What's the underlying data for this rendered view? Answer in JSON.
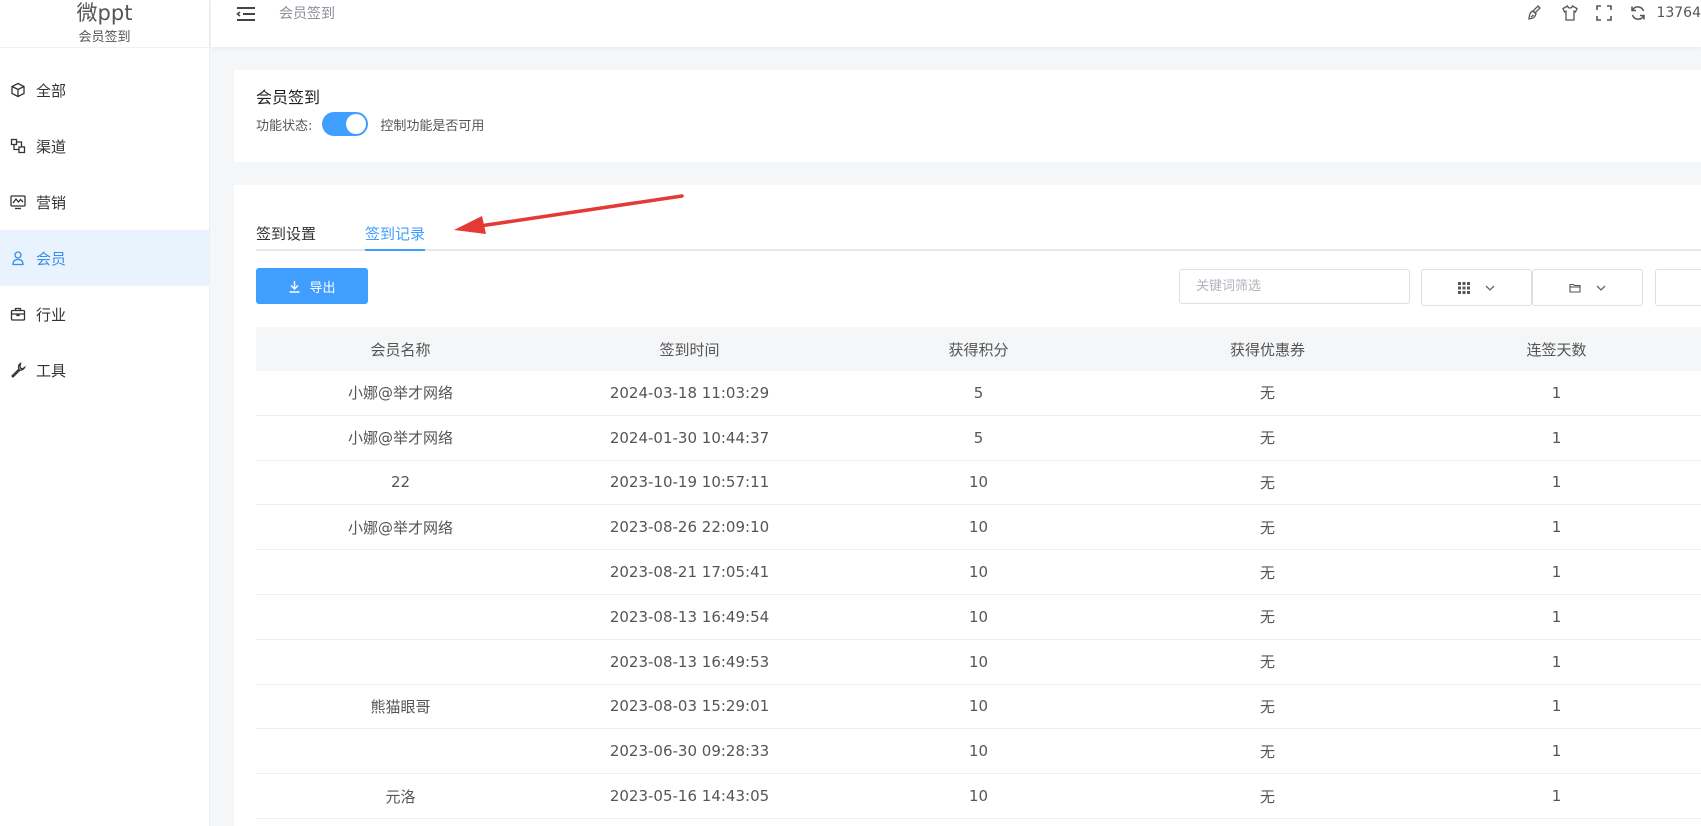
{
  "brand": {
    "name": "微ppt",
    "subtitle": "会员签到"
  },
  "sidebar": {
    "items": [
      {
        "label": "全部",
        "icon": "cube-icon"
      },
      {
        "label": "渠道",
        "icon": "channel-icon"
      },
      {
        "label": "营销",
        "icon": "chart-icon"
      },
      {
        "label": "会员",
        "icon": "user-icon",
        "active": true
      },
      {
        "label": "行业",
        "icon": "briefcase-icon"
      },
      {
        "label": "工具",
        "icon": "wrench-icon"
      }
    ]
  },
  "header": {
    "breadcrumb": "会员签到",
    "user": "13764",
    "icons": [
      "brush-icon",
      "shirt-icon",
      "fullscreen-icon",
      "refresh-icon"
    ]
  },
  "feature": {
    "title": "会员签到",
    "status_label": "功能状态:",
    "toggle_on": true,
    "description": "控制功能是否可用"
  },
  "tabs": [
    {
      "label": "签到设置",
      "active": false
    },
    {
      "label": "签到记录",
      "active": true
    }
  ],
  "toolbar": {
    "export_label": "导出",
    "search_placeholder": "关键词筛选"
  },
  "table": {
    "columns": [
      "会员名称",
      "签到时间",
      "获得积分",
      "获得优惠券",
      "连签天数"
    ],
    "rows": [
      [
        "小娜@举才网络",
        "2024-03-18 11:03:29",
        "5",
        "无",
        "1"
      ],
      [
        "小娜@举才网络",
        "2024-01-30 10:44:37",
        "5",
        "无",
        "1"
      ],
      [
        "22",
        "2023-10-19 10:57:11",
        "10",
        "无",
        "1"
      ],
      [
        "小娜@举才网络",
        "2023-08-26 22:09:10",
        "10",
        "无",
        "1"
      ],
      [
        "",
        "2023-08-21 17:05:41",
        "10",
        "无",
        "1"
      ],
      [
        "",
        "2023-08-13 16:49:54",
        "10",
        "无",
        "1"
      ],
      [
        "",
        "2023-08-13 16:49:53",
        "10",
        "无",
        "1"
      ],
      [
        "熊猫眼哥",
        "2023-08-03 15:29:01",
        "10",
        "无",
        "1"
      ],
      [
        "",
        "2023-06-30 09:28:33",
        "10",
        "无",
        "1"
      ],
      [
        "元洛",
        "2023-05-16 14:43:05",
        "10",
        "无",
        "1"
      ]
    ]
  },
  "colors": {
    "primary": "#409eff",
    "active_bg": "#e8f3fe",
    "arrow": "#e53935"
  }
}
